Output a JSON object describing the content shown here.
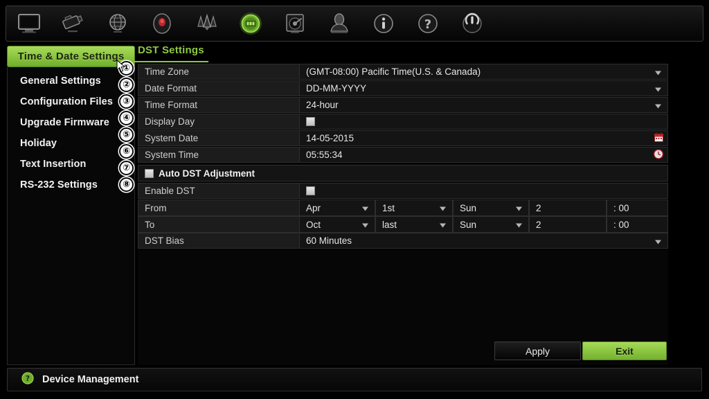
{
  "toolbar": {
    "icons": [
      {
        "name": "monitor-icon",
        "label": "Live View",
        "active": false
      },
      {
        "name": "camera-icon",
        "label": "Camera",
        "active": false
      },
      {
        "name": "network-icon",
        "label": "Network",
        "active": false
      },
      {
        "name": "record-icon",
        "label": "Record",
        "active": false
      },
      {
        "name": "alarm-icon",
        "label": "Alarm",
        "active": false
      },
      {
        "name": "system-config-icon",
        "label": "System Configuration",
        "active": true
      },
      {
        "name": "hdd-icon",
        "label": "HDD",
        "active": false
      },
      {
        "name": "user-icon",
        "label": "User Management",
        "active": false
      },
      {
        "name": "info-icon",
        "label": "System Info",
        "active": false
      },
      {
        "name": "help-icon",
        "label": "Help",
        "active": false
      },
      {
        "name": "power-icon",
        "label": "Shutdown",
        "active": false
      }
    ]
  },
  "tabs": {
    "primary_label": "Time & Date Settings",
    "secondary_label": "DST Settings"
  },
  "sidebar": {
    "items": [
      {
        "label": "General Settings"
      },
      {
        "label": "Configuration Files"
      },
      {
        "label": "Upgrade Firmware"
      },
      {
        "label": "Holiday"
      },
      {
        "label": "Text Insertion"
      },
      {
        "label": "RS-232 Settings"
      }
    ]
  },
  "callouts": [
    "①",
    "②",
    "③",
    "④",
    "⑤",
    "⑥",
    "⑦",
    "⑧"
  ],
  "form": {
    "time_zone": {
      "label": "Time Zone",
      "value": "(GMT-08:00) Pacific Time(U.S. & Canada)"
    },
    "date_format": {
      "label": "Date Format",
      "value": "DD-MM-YYYY"
    },
    "time_format": {
      "label": "Time Format",
      "value": "24-hour"
    },
    "display_day": {
      "label": "Display Day",
      "checked": true
    },
    "system_date": {
      "label": "System Date",
      "value": "14-05-2015",
      "icon": "calendar-icon"
    },
    "system_time": {
      "label": "System Time",
      "value": "05:55:34",
      "icon": "clock-icon"
    }
  },
  "dst": {
    "auto_adjust": {
      "label": "Auto DST Adjustment",
      "checked": true
    },
    "enable": {
      "label": "Enable DST",
      "checked": true
    },
    "from": {
      "label": "From",
      "month": "Apr",
      "week": "1st",
      "weekday": "Sun",
      "hour": "2",
      "minute": ": 00"
    },
    "to": {
      "label": "To",
      "month": "Oct",
      "week": "last",
      "weekday": "Sun",
      "hour": "2",
      "minute": ": 00"
    },
    "bias": {
      "label": "DST Bias",
      "value": "60 Minutes"
    }
  },
  "buttons": {
    "apply": "Apply",
    "exit": "Exit"
  },
  "statusbar": {
    "icon": "help-circle-icon",
    "text": "Device Management"
  },
  "colors": {
    "accent_green": "#8fc843",
    "panel_bg": "#141414",
    "label_bg": "#1c1c1c",
    "border": "#2e2e2e",
    "text": "#e6e6e6"
  }
}
